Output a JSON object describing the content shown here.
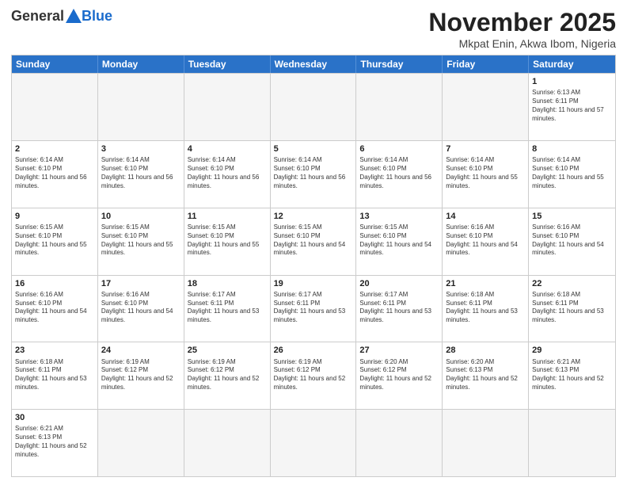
{
  "header": {
    "logo": {
      "general": "General",
      "blue": "Blue"
    },
    "title": "November 2025",
    "location": "Mkpat Enin, Akwa Ibom, Nigeria"
  },
  "calendar": {
    "days_of_week": [
      "Sunday",
      "Monday",
      "Tuesday",
      "Wednesday",
      "Thursday",
      "Friday",
      "Saturday"
    ],
    "weeks": [
      [
        {
          "day": "",
          "empty": true
        },
        {
          "day": "",
          "empty": true
        },
        {
          "day": "",
          "empty": true
        },
        {
          "day": "",
          "empty": true
        },
        {
          "day": "",
          "empty": true
        },
        {
          "day": "",
          "empty": true
        },
        {
          "day": "1",
          "sunrise": "6:13 AM",
          "sunset": "6:11 PM",
          "daylight": "11 hours and 57 minutes."
        }
      ],
      [
        {
          "day": "2",
          "sunrise": "6:14 AM",
          "sunset": "6:10 PM",
          "daylight": "11 hours and 56 minutes."
        },
        {
          "day": "3",
          "sunrise": "6:14 AM",
          "sunset": "6:10 PM",
          "daylight": "11 hours and 56 minutes."
        },
        {
          "day": "4",
          "sunrise": "6:14 AM",
          "sunset": "6:10 PM",
          "daylight": "11 hours and 56 minutes."
        },
        {
          "day": "5",
          "sunrise": "6:14 AM",
          "sunset": "6:10 PM",
          "daylight": "11 hours and 56 minutes."
        },
        {
          "day": "6",
          "sunrise": "6:14 AM",
          "sunset": "6:10 PM",
          "daylight": "11 hours and 56 minutes."
        },
        {
          "day": "7",
          "sunrise": "6:14 AM",
          "sunset": "6:10 PM",
          "daylight": "11 hours and 55 minutes."
        },
        {
          "day": "8",
          "sunrise": "6:14 AM",
          "sunset": "6:10 PM",
          "daylight": "11 hours and 55 minutes."
        }
      ],
      [
        {
          "day": "9",
          "sunrise": "6:15 AM",
          "sunset": "6:10 PM",
          "daylight": "11 hours and 55 minutes."
        },
        {
          "day": "10",
          "sunrise": "6:15 AM",
          "sunset": "6:10 PM",
          "daylight": "11 hours and 55 minutes."
        },
        {
          "day": "11",
          "sunrise": "6:15 AM",
          "sunset": "6:10 PM",
          "daylight": "11 hours and 55 minutes."
        },
        {
          "day": "12",
          "sunrise": "6:15 AM",
          "sunset": "6:10 PM",
          "daylight": "11 hours and 54 minutes."
        },
        {
          "day": "13",
          "sunrise": "6:15 AM",
          "sunset": "6:10 PM",
          "daylight": "11 hours and 54 minutes."
        },
        {
          "day": "14",
          "sunrise": "6:16 AM",
          "sunset": "6:10 PM",
          "daylight": "11 hours and 54 minutes."
        },
        {
          "day": "15",
          "sunrise": "6:16 AM",
          "sunset": "6:10 PM",
          "daylight": "11 hours and 54 minutes."
        }
      ],
      [
        {
          "day": "16",
          "sunrise": "6:16 AM",
          "sunset": "6:10 PM",
          "daylight": "11 hours and 54 minutes."
        },
        {
          "day": "17",
          "sunrise": "6:16 AM",
          "sunset": "6:10 PM",
          "daylight": "11 hours and 54 minutes."
        },
        {
          "day": "18",
          "sunrise": "6:17 AM",
          "sunset": "6:11 PM",
          "daylight": "11 hours and 53 minutes."
        },
        {
          "day": "19",
          "sunrise": "6:17 AM",
          "sunset": "6:11 PM",
          "daylight": "11 hours and 53 minutes."
        },
        {
          "day": "20",
          "sunrise": "6:17 AM",
          "sunset": "6:11 PM",
          "daylight": "11 hours and 53 minutes."
        },
        {
          "day": "21",
          "sunrise": "6:18 AM",
          "sunset": "6:11 PM",
          "daylight": "11 hours and 53 minutes."
        },
        {
          "day": "22",
          "sunrise": "6:18 AM",
          "sunset": "6:11 PM",
          "daylight": "11 hours and 53 minutes."
        }
      ],
      [
        {
          "day": "23",
          "sunrise": "6:18 AM",
          "sunset": "6:11 PM",
          "daylight": "11 hours and 53 minutes."
        },
        {
          "day": "24",
          "sunrise": "6:19 AM",
          "sunset": "6:12 PM",
          "daylight": "11 hours and 52 minutes."
        },
        {
          "day": "25",
          "sunrise": "6:19 AM",
          "sunset": "6:12 PM",
          "daylight": "11 hours and 52 minutes."
        },
        {
          "day": "26",
          "sunrise": "6:19 AM",
          "sunset": "6:12 PM",
          "daylight": "11 hours and 52 minutes."
        },
        {
          "day": "27",
          "sunrise": "6:20 AM",
          "sunset": "6:12 PM",
          "daylight": "11 hours and 52 minutes."
        },
        {
          "day": "28",
          "sunrise": "6:20 AM",
          "sunset": "6:13 PM",
          "daylight": "11 hours and 52 minutes."
        },
        {
          "day": "29",
          "sunrise": "6:21 AM",
          "sunset": "6:13 PM",
          "daylight": "11 hours and 52 minutes."
        }
      ],
      [
        {
          "day": "30",
          "sunrise": "6:21 AM",
          "sunset": "6:13 PM",
          "daylight": "11 hours and 52 minutes."
        },
        {
          "day": "",
          "empty": true
        },
        {
          "day": "",
          "empty": true
        },
        {
          "day": "",
          "empty": true
        },
        {
          "day": "",
          "empty": true
        },
        {
          "day": "",
          "empty": true
        },
        {
          "day": "",
          "empty": true
        }
      ]
    ]
  }
}
